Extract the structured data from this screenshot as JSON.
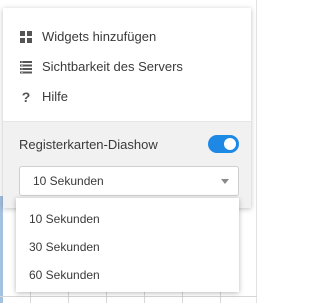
{
  "menu": {
    "items": [
      {
        "label": "Widgets hinzufügen",
        "icon": "grid-icon"
      },
      {
        "label": "Sichtbarkeit des Servers",
        "icon": "server-list-icon"
      },
      {
        "label": "Hilfe",
        "icon": "question-icon"
      }
    ],
    "slideshow": {
      "label": "Registerkarten-Diashow",
      "enabled": true
    },
    "select": {
      "value": "10 Sekunden"
    }
  },
  "dropdown": {
    "options": [
      "10 Sekunden",
      "30 Sekunden",
      "60 Sekunden"
    ]
  },
  "colors": {
    "accent": "#1e88e5",
    "text": "#3a3a3a",
    "section_bg": "#f1f1f1"
  }
}
